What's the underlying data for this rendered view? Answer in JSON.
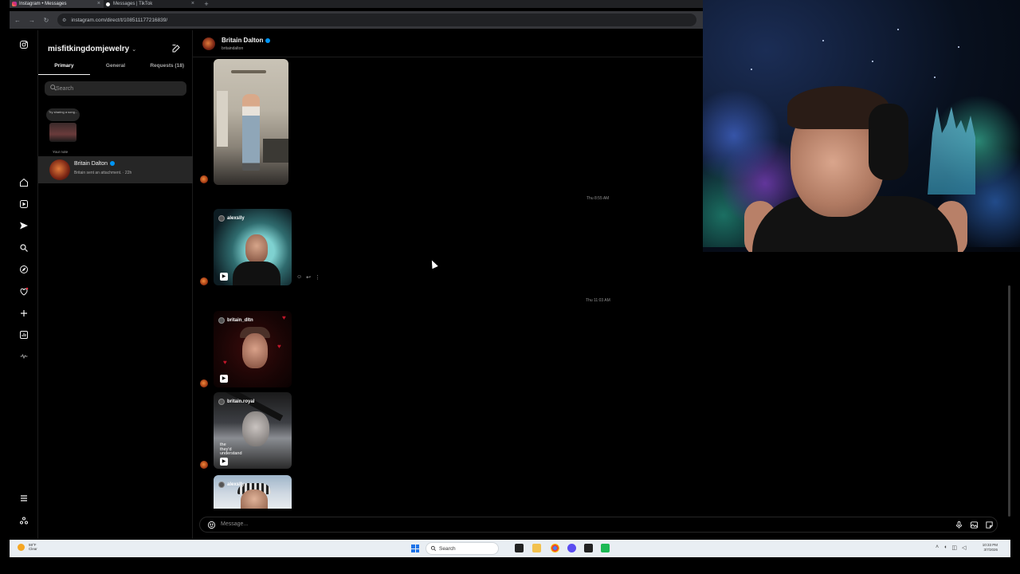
{
  "browser": {
    "tabs": [
      {
        "title": "Instagram • Messages",
        "active": true
      },
      {
        "title": "Messages | TikTok",
        "active": false
      }
    ],
    "new_tab": "+",
    "url": "instagram.com/direct/t/108511177216839/"
  },
  "instagram": {
    "account_name": "misfitkingdomjewelry",
    "inbox_tabs": [
      "Primary",
      "General",
      "Requests (18)"
    ],
    "search_placeholder": "Search",
    "note": {
      "bubble_text": "Try sharing a song...",
      "label": "Your note"
    },
    "threads": [
      {
        "name": "Britain Dalton",
        "verified": true,
        "preview": "Britain sent an attachment. · 22h"
      }
    ]
  },
  "chat": {
    "name": "Britain Dalton",
    "username": "britaindalton",
    "verified": true,
    "messages": [
      {
        "kind": "video",
        "label": ""
      },
      {
        "kind": "timestamp",
        "text": "Thu 8:55 AM"
      },
      {
        "kind": "reel",
        "handle": "alexslly"
      },
      {
        "kind": "timestamp",
        "text": "Thu 11:03 AM"
      },
      {
        "kind": "reel",
        "handle": "britain_dltn"
      },
      {
        "kind": "reel",
        "handle": "britain.royal",
        "caption": "the\nthey'd\nunderstand"
      },
      {
        "kind": "reel",
        "handle": "alexslly"
      }
    ],
    "composer_placeholder": "Message..."
  },
  "taskbar": {
    "weather_temp": "59°F",
    "weather_desc": "Clear",
    "search_label": "Search",
    "time": "10:33 PM",
    "date": "3/7/2026"
  },
  "colors": {
    "ig_bg": "#000000",
    "verified_blue": "#0095f6",
    "thread_selected": "#262626",
    "taskbar_bg": "#e9eef3"
  }
}
